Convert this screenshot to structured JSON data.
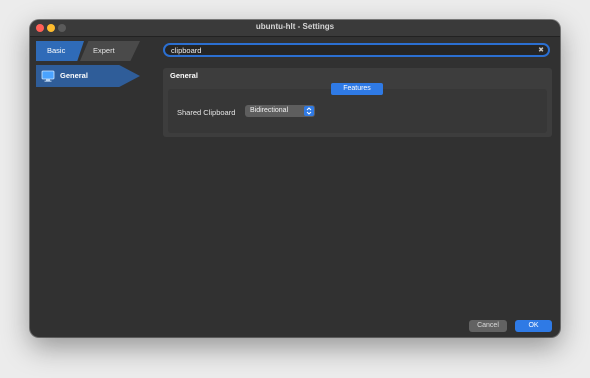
{
  "window": {
    "title": "ubuntu-hlt - Settings"
  },
  "sidebar": {
    "tabs": [
      {
        "label": "Basic",
        "active": true
      },
      {
        "label": "Expert",
        "active": false
      }
    ],
    "items": [
      {
        "label": "General",
        "icon": "monitor-icon",
        "selected": true
      }
    ],
    "help_icon": "question-mark-icon"
  },
  "search": {
    "value": "clipboard",
    "placeholder": "",
    "clear_icon": "clear-x-icon"
  },
  "section": {
    "title": "General",
    "group_label": "Features",
    "fields": [
      {
        "label": "Shared Clipboard",
        "value": "Bidirectional",
        "control": "dropdown"
      }
    ]
  },
  "footer": {
    "cancel_label": "Cancel",
    "ok_label": "OK"
  },
  "colors": {
    "accent": "#2f7ae5",
    "sidebar_selected": "#2f5d99",
    "background": "#313131",
    "panel": "#3d3d3d"
  }
}
